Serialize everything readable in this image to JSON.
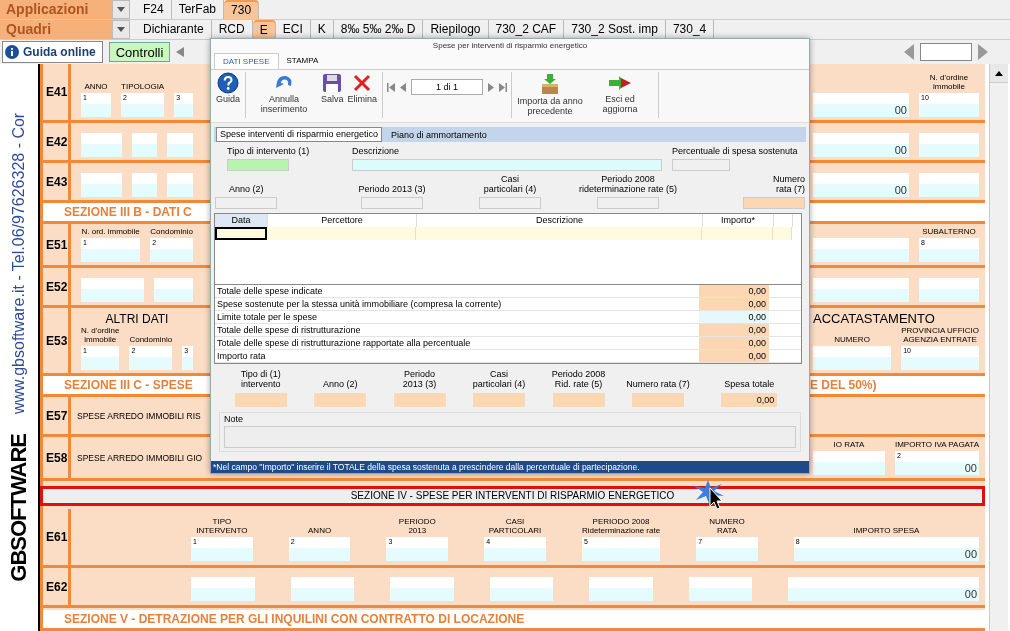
{
  "app_bar": {
    "menus": [
      {
        "label": "Applicazioni",
        "tabs": [
          {
            "label": "F24",
            "selected": false
          },
          {
            "label": "TerFab",
            "selected": false
          },
          {
            "label": "730",
            "selected": true
          }
        ]
      },
      {
        "label": "Quadri",
        "tabs": [
          {
            "label": "Dichiarante",
            "selected": false
          },
          {
            "label": "RCD",
            "selected": false
          },
          {
            "label": "E",
            "selected": true
          },
          {
            "label": "ECI",
            "selected": false
          },
          {
            "label": "K",
            "selected": false
          },
          {
            "label": "8‰  5‰  2‰  D",
            "selected": false
          },
          {
            "label": "Riepilogo",
            "selected": false
          },
          {
            "label": "730_2 CAF",
            "selected": false
          },
          {
            "label": "730_2 Sost. imp",
            "selected": false
          },
          {
            "label": "730_4",
            "selected": false
          }
        ]
      }
    ]
  },
  "toolbar": {
    "help_button": "Guida online",
    "check_button": "Controlli"
  },
  "sidebar": {
    "site_text": "www.gbsoftware.it - Tel.06/97626328 - Cor",
    "logo": "GBSOFTWARE"
  },
  "form": {
    "rows": [
      {
        "kind": "entry",
        "code": "E41",
        "left": [
          {
            "kind": "box",
            "header": [
              "ANNO"
            ],
            "number": "1"
          },
          {
            "kind": "box",
            "header": [
              "TIPOLOGIA"
            ],
            "number": "2"
          },
          {
            "kind": "box",
            "number": "3"
          }
        ],
        "right": [
          {
            "kind": "box",
            "amount": "00"
          },
          {
            "kind": "box",
            "header": [
              "N. d'ordine",
              "immobile"
            ],
            "number": "10"
          }
        ]
      },
      {
        "kind": "entry",
        "code": "E42",
        "left": [
          {
            "kind": "box"
          },
          {
            "kind": "box"
          },
          {
            "kind": "box"
          }
        ],
        "right": [
          {
            "kind": "box",
            "amount": "00"
          },
          {
            "kind": "box"
          }
        ]
      },
      {
        "kind": "entry",
        "code": "E43",
        "left": [
          {
            "kind": "box"
          },
          {
            "kind": "box"
          },
          {
            "kind": "box"
          }
        ],
        "right": [
          {
            "kind": "box",
            "amount": "00"
          },
          {
            "kind": "box"
          }
        ]
      },
      {
        "kind": "section",
        "left": "SEZIONE III B - DATI C"
      },
      {
        "kind": "entry",
        "code": "E51",
        "left": [
          {
            "kind": "box",
            "header": [
              "N. ord. immobile"
            ],
            "number": "1"
          },
          {
            "kind": "box",
            "header": [
              "Condominio"
            ],
            "number": "2"
          }
        ],
        "right": [
          {
            "kind": "box"
          },
          {
            "kind": "box",
            "header": [
              "SUBALTERNO"
            ],
            "number": "8"
          }
        ]
      },
      {
        "kind": "entry",
        "code": "E52",
        "left": [
          {
            "kind": "box"
          },
          {
            "kind": "box"
          }
        ],
        "right": [
          {
            "kind": "box"
          },
          {
            "kind": "box"
          }
        ]
      },
      {
        "kind": "entry",
        "code": "E53",
        "left_heading": "ALTRI DATI",
        "right_heading": "ACCATASTAMENTO",
        "left": [
          {
            "kind": "box",
            "header": [
              "N. d'ordine",
              "immobile"
            ],
            "number": "1"
          },
          {
            "kind": "box",
            "header": [
              "Condominio"
            ],
            "number": "2"
          },
          {
            "kind": "box",
            "number": "3"
          }
        ],
        "right": [
          {
            "kind": "box",
            "header": [
              "NUMERO"
            ]
          },
          {
            "kind": "box",
            "header": [
              "PROVINCIA UFFICIO",
              "AGENZIA ENTRATE"
            ],
            "number": "10"
          }
        ]
      },
      {
        "kind": "section",
        "left": "SEZIONE III C - SPESE",
        "right": "E DEL 50%)"
      },
      {
        "kind": "text",
        "code": "E57",
        "text": "SPESE ARREDO IMMOBILI RIS"
      },
      {
        "kind": "text",
        "code": "E58",
        "text": "SPESE ARREDO IMMOBILI GIO",
        "right": [
          {
            "kind": "box",
            "header": [
              "IO RATA"
            ]
          },
          {
            "kind": "box",
            "header": [
              "IMPORTO IVA PAGATA"
            ],
            "number": "2",
            "amount": "00"
          }
        ]
      }
    ],
    "section_four": {
      "title": "SEZIONE IV - SPESE PER INTERVENTI DI RISPARMIO ENERGETICO",
      "rows": [
        {
          "code": "E61",
          "cells": [
            {
              "kind": "box",
              "header": [
                "TIPO",
                "INTERVENTO"
              ],
              "number": "1"
            },
            {
              "kind": "box",
              "header": [
                "ANNO"
              ],
              "number": "2"
            },
            {
              "kind": "box",
              "header": [
                "PERIODO",
                "2013"
              ],
              "number": "3"
            },
            {
              "kind": "box",
              "header": [
                "CASI",
                "PARTICOLARI"
              ],
              "number": "4"
            },
            {
              "kind": "box",
              "header": [
                "PERIODO 2008",
                "Rideterminazione rate"
              ],
              "number": "5"
            },
            {
              "kind": "box",
              "header": [
                "NUMERO",
                "RATA"
              ],
              "number": "7"
            },
            {
              "kind": "box",
              "header": [
                "IMPORTO SPESA"
              ],
              "number": "8",
              "amount": "00"
            }
          ]
        },
        {
          "code": "E62",
          "cells": [
            {
              "kind": "box"
            },
            {
              "kind": "box"
            },
            {
              "kind": "box"
            },
            {
              "kind": "box"
            },
            {
              "kind": "box"
            },
            {
              "kind": "box"
            },
            {
              "kind": "box",
              "amount": "00"
            }
          ]
        }
      ]
    },
    "next_section": "SEZIONE V  -  DETRAZIONE PER GLI INQUILINI CON CONTRATTO DI LOCAZIONE"
  },
  "dialog": {
    "title": "Spese per interventi di risparmio energetico",
    "ribbon_tabs": [
      {
        "label": "DATI SPESE",
        "selected": true
      },
      {
        "label": "STAMPA",
        "selected": false
      }
    ],
    "toolbar_groups": [
      [
        {
          "kind": "help",
          "label": "Guida"
        }
      ],
      [
        {
          "kind": "undo",
          "label": "Annulla inserimento"
        },
        {
          "kind": "save",
          "label": "Salva"
        },
        {
          "kind": "delete",
          "label": "Elimina"
        }
      ],
      [
        {
          "kind": "pager",
          "value": "1 di 1"
        }
      ],
      [
        {
          "kind": "import",
          "label": "Importa da anno precedente"
        },
        {
          "kind": "exit",
          "label": "Esci ed aggiorna"
        }
      ]
    ],
    "inner_tabs": [
      {
        "label": "Spese interventi di risparmio energetico",
        "selected": true
      },
      {
        "label": "Piano di ammortamento",
        "selected": false
      }
    ],
    "fields_top": [
      {
        "lines": [
          "Tipo di intervento (1)"
        ],
        "kind": "key"
      },
      {
        "lines": [
          "Descrizione"
        ],
        "kind": "text"
      },
      {
        "lines": [
          "Percentuale di spesa sostenuta"
        ],
        "kind": "readonly"
      }
    ],
    "fields_mid": [
      {
        "lines": [
          "Anno (2)"
        ],
        "kind": "readonly"
      },
      {
        "lines": [
          "Periodo 2013 (3)"
        ],
        "kind": "readonly"
      },
      {
        "lines": [
          "Casi",
          "particolari (4)"
        ],
        "kind": "readonly"
      },
      {
        "lines": [
          "Periodo 2008",
          "rideterminazione rate (5)"
        ],
        "kind": "readonly"
      },
      {
        "lines": [
          "Numero",
          "rata (7)"
        ],
        "kind": "computed"
      }
    ],
    "grid": {
      "columns": [
        "Data",
        "Percettore",
        "Descrizione",
        "Importo*"
      ]
    },
    "totals": [
      {
        "label": "Totale delle spese indicate",
        "value": "0,00",
        "kind": "computed"
      },
      {
        "label": "Spese sostenute per la stessa unità immobiliare (compresa la corrente)",
        "value": "0,00",
        "kind": "computed"
      },
      {
        "label": "Limite totale per le spese",
        "value": "0,00",
        "kind": "input"
      },
      {
        "label": "Totale delle spese di ristrutturazione",
        "value": "0,00",
        "kind": "computed"
      },
      {
        "label": "Totale delle spese di ristrutturazione rapportate alla percentuale",
        "value": "0,00",
        "kind": "computed"
      },
      {
        "label": "Importo rata",
        "value": "0,00",
        "kind": "computed"
      }
    ],
    "summary": [
      {
        "lines": [
          "Tipo di (1)",
          "intervento"
        ],
        "kind": "computed"
      },
      {
        "lines": [
          "Anno (2)"
        ],
        "kind": "computed"
      },
      {
        "lines": [
          "Periodo",
          "2013 (3)"
        ],
        "kind": "computed"
      },
      {
        "lines": [
          "Casi",
          "particolari (4)"
        ],
        "kind": "computed"
      },
      {
        "lines": [
          "Periodo 2008",
          "Rid. rate (5)"
        ],
        "kind": "computed"
      },
      {
        "lines": [
          "Numero rata (7)"
        ],
        "kind": "computed"
      },
      {
        "lines": [
          "Spesa totale"
        ],
        "kind": "computed",
        "value": "0,00"
      }
    ],
    "note_label": "Note",
    "footer": "*Nel campo \"Importo\" inserire il TOTALE della spesa sostenuta a prescindere dalla percentuale di partecipazione."
  }
}
